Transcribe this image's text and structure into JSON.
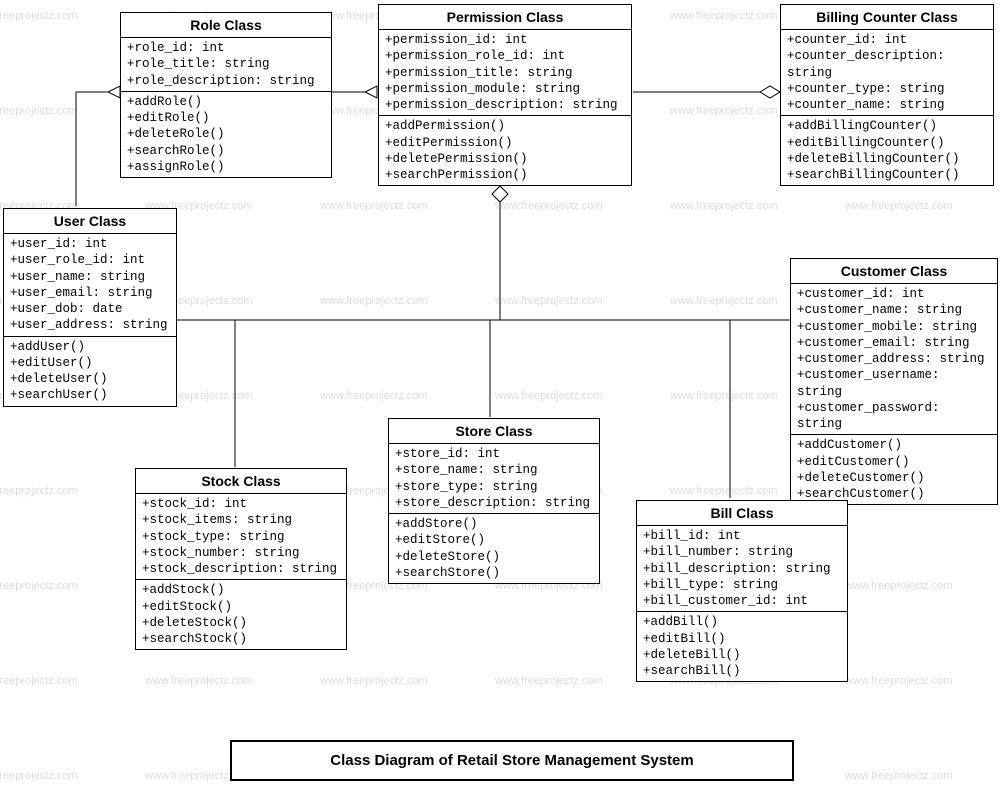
{
  "watermark": "www.freeprojectz.com",
  "caption": "Class Diagram of Retail Store Management System",
  "classes": {
    "role": {
      "title": "Role Class",
      "attrs": [
        "+role_id: int",
        "+role_title: string",
        "+role_description: string"
      ],
      "ops": [
        "+addRole()",
        "+editRole()",
        "+deleteRole()",
        "+searchRole()",
        "+assignRole()"
      ]
    },
    "permission": {
      "title": "Permission Class",
      "attrs": [
        "+permission_id: int",
        "+permission_role_id: int",
        "+permission_title: string",
        "+permission_module: string",
        "+permission_description: string"
      ],
      "ops": [
        "+addPermission()",
        "+editPermission()",
        "+deletePermission()",
        "+searchPermission()"
      ]
    },
    "billing": {
      "title": "Billing Counter Class",
      "attrs": [
        "+counter_id: int",
        "+counter_description: string",
        "+counter_type: string",
        "+counter_name: string"
      ],
      "ops": [
        "+addBillingCounter()",
        "+editBillingCounter()",
        "+deleteBillingCounter()",
        "+searchBillingCounter()"
      ]
    },
    "user": {
      "title": "User Class",
      "attrs": [
        "+user_id: int",
        "+user_role_id: int",
        "+user_name: string",
        "+user_email: string",
        "+user_dob: date",
        "+user_address: string"
      ],
      "ops": [
        "+addUser()",
        "+editUser()",
        "+deleteUser()",
        "+searchUser()"
      ]
    },
    "customer": {
      "title": "Customer Class",
      "attrs": [
        "+customer_id: int",
        "+customer_name: string",
        "+customer_mobile: string",
        "+customer_email: string",
        "+customer_address: string",
        "+customer_username: string",
        "+customer_password: string"
      ],
      "ops": [
        "+addCustomer()",
        "+editCustomer()",
        "+deleteCustomer()",
        "+searchCustomer()"
      ]
    },
    "stock": {
      "title": "Stock Class",
      "attrs": [
        "+stock_id: int",
        "+stock_items: string",
        "+stock_type: string",
        "+stock_number: string",
        "+stock_description: string"
      ],
      "ops": [
        "+addStock()",
        "+editStock()",
        "+deleteStock()",
        "+searchStock()"
      ]
    },
    "store": {
      "title": "Store Class",
      "attrs": [
        "+store_id: int",
        "+store_name: string",
        "+store_type: string",
        "+store_description: string"
      ],
      "ops": [
        "+addStore()",
        "+editStore()",
        "+deleteStore()",
        "+searchStore()"
      ]
    },
    "bill": {
      "title": "Bill Class",
      "attrs": [
        "+bill_id: int",
        "+bill_number: string",
        "+bill_description: string",
        "+bill_type: string",
        "+bill_customer_id: int"
      ],
      "ops": [
        "+addBill()",
        "+editBill()",
        "+deleteBill()",
        "+searchBill()"
      ]
    }
  }
}
